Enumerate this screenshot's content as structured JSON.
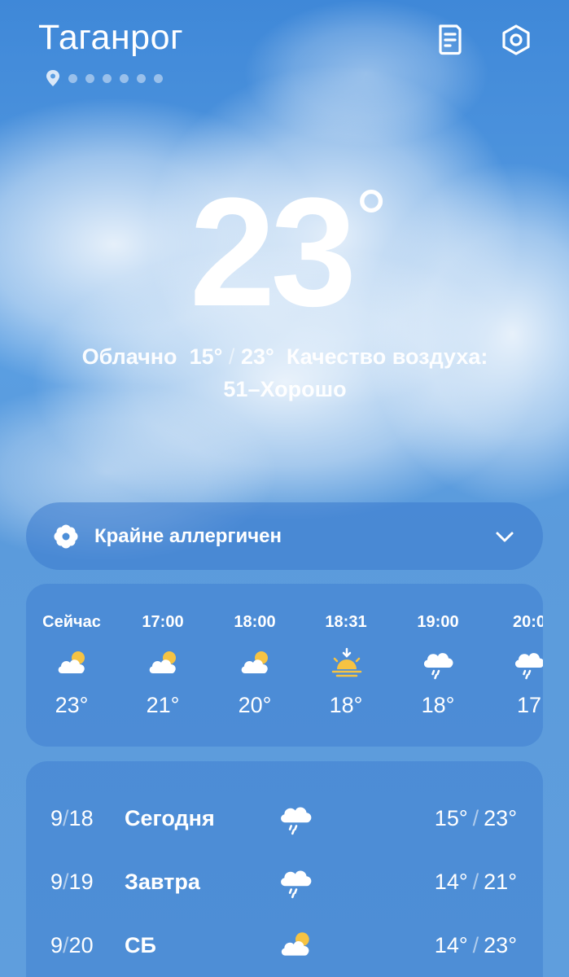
{
  "header": {
    "city": "Таганрог",
    "page_dots": 6
  },
  "current": {
    "temperature": "23",
    "degree_symbol": "°",
    "condition": "Облачно",
    "low": "15°",
    "high": "23°",
    "range_separator": "/",
    "air_quality_label": "Качество воздуха:",
    "air_quality_value": "51–Хорошо"
  },
  "allergy": {
    "label": "Крайне аллергичен"
  },
  "hourly": [
    {
      "time": "Сейчас",
      "icon": "partly-cloudy-icon",
      "temp": "23°"
    },
    {
      "time": "17:00",
      "icon": "partly-cloudy-icon",
      "temp": "21°"
    },
    {
      "time": "18:00",
      "icon": "partly-cloudy-icon",
      "temp": "20°"
    },
    {
      "time": "18:31",
      "icon": "sunset-icon",
      "temp": "18°"
    },
    {
      "time": "19:00",
      "icon": "rain-icon",
      "temp": "18°"
    },
    {
      "time": "20:0",
      "icon": "rain-icon",
      "temp": "17"
    }
  ],
  "daily": [
    {
      "month": "9",
      "day": "18",
      "name": "Сегодня",
      "icon": "rain-icon",
      "low": "15°",
      "high": "23°"
    },
    {
      "month": "9",
      "day": "19",
      "name": "Завтра",
      "icon": "rain-icon",
      "low": "14°",
      "high": "21°"
    },
    {
      "month": "9",
      "day": "20",
      "name": "СБ",
      "icon": "partly-cloudy-icon",
      "low": "14°",
      "high": "23°"
    }
  ],
  "colors": {
    "sun": "#f6c343",
    "card": "#3a7ace"
  }
}
